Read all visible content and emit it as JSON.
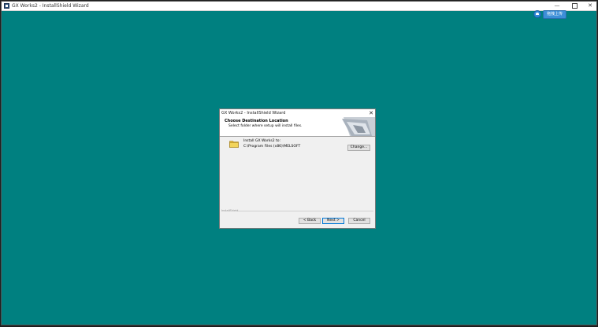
{
  "outer_window": {
    "title": "GX Works2 - InstallShield Wizard",
    "controls": {
      "minimize": "—",
      "close": "✕"
    }
  },
  "upload_widget": {
    "label": "拖拽上传"
  },
  "dialog": {
    "title": "GX Works2 - InstallShield Wizard",
    "close": "✕",
    "heading": "Choose Destination Location",
    "subheading": "Select folder where setup will install files.",
    "install_to": "Install GX Works2 to:",
    "path": "C:\\Program Files (x86)\\MELSOFT",
    "change_button": "Change...",
    "installshield_label": "InstallShield",
    "back_button": "< Back",
    "next_button": "Next >",
    "cancel_button": "Cancel"
  },
  "colors": {
    "desktop": "#008080",
    "accent": "#0078d7",
    "folder": "#f2d45a"
  }
}
